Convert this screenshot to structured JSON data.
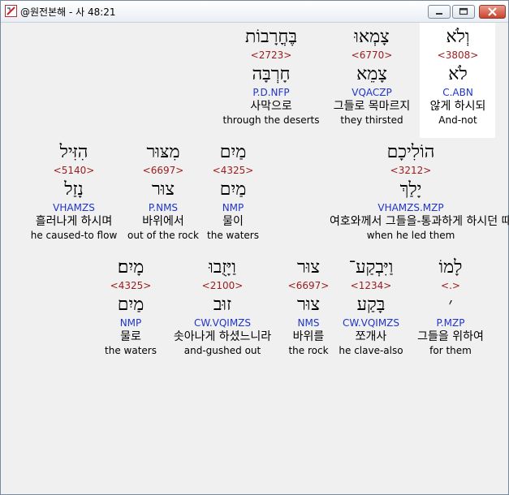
{
  "window": {
    "title": "@원전본해 - 사 48:21"
  },
  "colors": {
    "strong": "#9b1b1b",
    "parse": "#1f35c8",
    "highlight": "#ffffff"
  },
  "rows": [
    [
      {
        "word": "וְלֹא",
        "strong": "<3808>",
        "lemma": "לֹא",
        "parse": "C.ABN",
        "korean": "않게 하시되",
        "english": "And-not"
      },
      {
        "word": "צָמְאוּ",
        "strong": "<6770>",
        "lemma": "צָמֵא",
        "parse": "VQACZP",
        "korean": "그들로 목마르지",
        "english": "they thirsted"
      },
      {
        "word": "בֶּחֳרָבוֹת",
        "strong": "<2723>",
        "lemma": "חָרְבָּה",
        "parse": "P.D.NFP",
        "korean": "사막으로",
        "english": "through the deserts"
      }
    ],
    [
      {
        "word": "הוֹלִיכָם",
        "strong": "<3212>",
        "lemma": "יָלַךְ",
        "parse": "VHAMZS.MZP",
        "korean": "여호와께서 그들을-통과하게 하시던 때에",
        "english": "when he led them"
      },
      {
        "word": "מַיִם",
        "strong": "<4325>",
        "lemma": "מַיִם",
        "parse": "NMP",
        "korean": "물이",
        "english": "the waters"
      },
      {
        "word": "מִצּוּר",
        "strong": "<6697>",
        "lemma": "צוּר",
        "parse": "P.NMS",
        "korean": "바위에서",
        "english": "out of the rock"
      },
      {
        "word": "הִזִּיל",
        "strong": "<5140>",
        "lemma": "נָזַל",
        "parse": "VHAMZS",
        "korean": "흘러나게 하시며",
        "english": "he caused-to flow"
      }
    ],
    [
      {
        "word": "לָמוֹ",
        "strong": "<.>",
        "lemma": "׳",
        "parse": "P.MZP",
        "korean": "그들을 위하여",
        "english": "for them"
      },
      {
        "word": "וַיִּבְקַע־",
        "strong": "<1234>",
        "lemma": "בָּקַע",
        "parse": "CW.VQIMZS",
        "korean": "쪼개사",
        "english": "he clave-also"
      },
      {
        "word": "צוּר",
        "strong": "<6697>",
        "lemma": "צוּר",
        "parse": "NMS",
        "korean": "바위를",
        "english": "the rock"
      },
      {
        "word": "וַיָּזֻבוּ",
        "strong": "<2100>",
        "lemma": "זוּב",
        "parse": "CW.VQIMZS",
        "korean": "솟아나게 하셨느니라",
        "english": "and-gushed out"
      },
      {
        "word": "מָיִם׃",
        "strong": "<4325>",
        "lemma": "מַיִם",
        "parse": "NMP",
        "korean": "물로",
        "english": "the waters"
      }
    ]
  ]
}
